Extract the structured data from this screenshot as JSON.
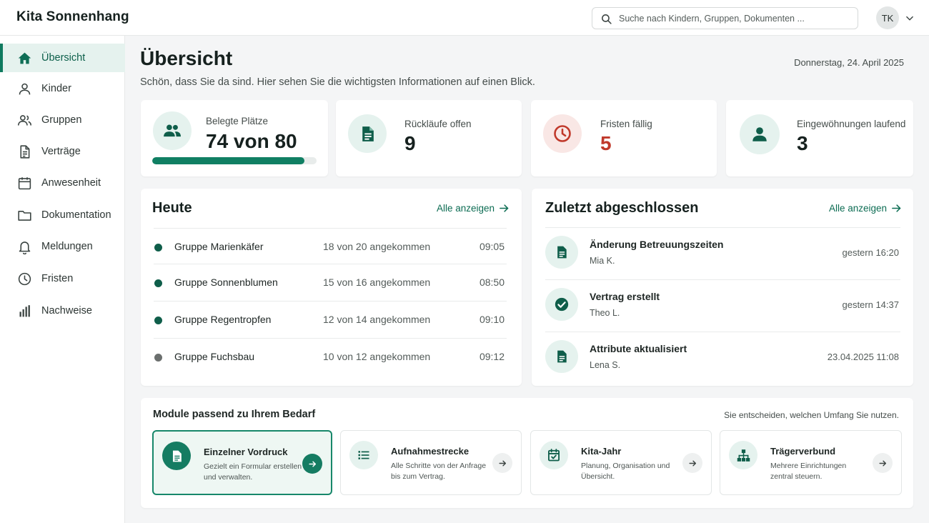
{
  "app": {
    "title": "Kita Sonnenhang"
  },
  "search": {
    "placeholder": "Suche nach Kindern, Gruppen, Dokumenten ..."
  },
  "user": {
    "initials": "TK"
  },
  "sidebar": {
    "items": [
      {
        "label": "Übersicht",
        "icon": "home-icon",
        "active": true
      },
      {
        "label": "Kinder",
        "icon": "person-icon"
      },
      {
        "label": "Gruppen",
        "icon": "group-icon"
      },
      {
        "label": "Verträge",
        "icon": "document-icon"
      },
      {
        "label": "Anwesenheit",
        "icon": "calendar-icon"
      },
      {
        "label": "Dokumentation",
        "icon": "folder-icon"
      },
      {
        "label": "Meldungen",
        "icon": "bell-icon"
      },
      {
        "label": "Fristen",
        "icon": "clock-icon"
      },
      {
        "label": "Nachweise",
        "icon": "bar-chart-icon"
      }
    ]
  },
  "page": {
    "title": "Übersicht",
    "subtitle": "Schön, dass Sie da sind. Hier sehen Sie die wichtigsten Informationen auf einen Blick.",
    "date": "Donnerstag, 24. April 2025"
  },
  "stats": [
    {
      "label": "Belegte Plätze",
      "value": "74 von 80",
      "icon": "group-icon",
      "progress_fraction": 0.925
    },
    {
      "label": "Rückläufe offen",
      "value": "9",
      "icon": "document-icon"
    },
    {
      "label": "Fristen fällig",
      "value": "5",
      "icon": "clock-icon",
      "accent": "#c0392b"
    },
    {
      "label": "Eingewöhnungen laufend",
      "value": "3",
      "icon": "person-icon"
    }
  ],
  "today": {
    "title": "Heute",
    "link": "Alle anzeigen",
    "rows": [
      {
        "group": "Gruppe Marienkäfer",
        "count": "18 von 20 angekommen",
        "time": "09:05",
        "status_color": "#0f5e4a"
      },
      {
        "group": "Gruppe Sonnenblumen",
        "count": "15 von 16 angekommen",
        "time": "08:50",
        "status_color": "#0f5e4a"
      },
      {
        "group": "Gruppe Regentropfen",
        "count": "12 von 14 angekommen",
        "time": "09:10",
        "status_color": "#0f5e4a"
      },
      {
        "group": "Gruppe Fuchsbau",
        "count": "10 von 12 angekommen",
        "time": "09:12",
        "status_color": "#6b6f6e"
      }
    ]
  },
  "recent": {
    "title": "Zuletzt abgeschlossen",
    "link": "Alle anzeigen",
    "rows": [
      {
        "title": "Änderung Betreuungszeiten",
        "person": "Mia K.",
        "time": "gestern 16:20",
        "icon": "document-icon"
      },
      {
        "title": "Vertrag erstellt",
        "person": "Theo L.",
        "time": "gestern 14:37",
        "icon": "check-circle-icon"
      },
      {
        "title": "Attribute aktualisiert",
        "person": "Lena S.",
        "time": "23.04.2025 11:08",
        "icon": "document-icon"
      }
    ]
  },
  "modules": {
    "title": "Module passend zu Ihrem Bedarf",
    "note": "Sie entscheiden, welchen Umfang Sie nutzen.",
    "items": [
      {
        "name": "Einzelner Vordruck",
        "description": "Gezielt ein Formular erstellen und verwalten.",
        "icon": "document-icon",
        "selected": true
      },
      {
        "name": "Aufnahmestrecke",
        "description": "Alle Schritte von der Anfrage bis zum Vertrag.",
        "icon": "list-icon"
      },
      {
        "name": "Kita-Jahr",
        "description": "Planung, Organisation und Übersicht.",
        "icon": "calendar-check-icon"
      },
      {
        "name": "Trägerverbund",
        "description": "Mehrere Einrichtungen zentral steuern.",
        "icon": "hierarchy-icon"
      }
    ]
  },
  "colors": {
    "primary": "#0f7a5f",
    "primary_light": "#e5f2ee",
    "danger": "#c0392b"
  }
}
